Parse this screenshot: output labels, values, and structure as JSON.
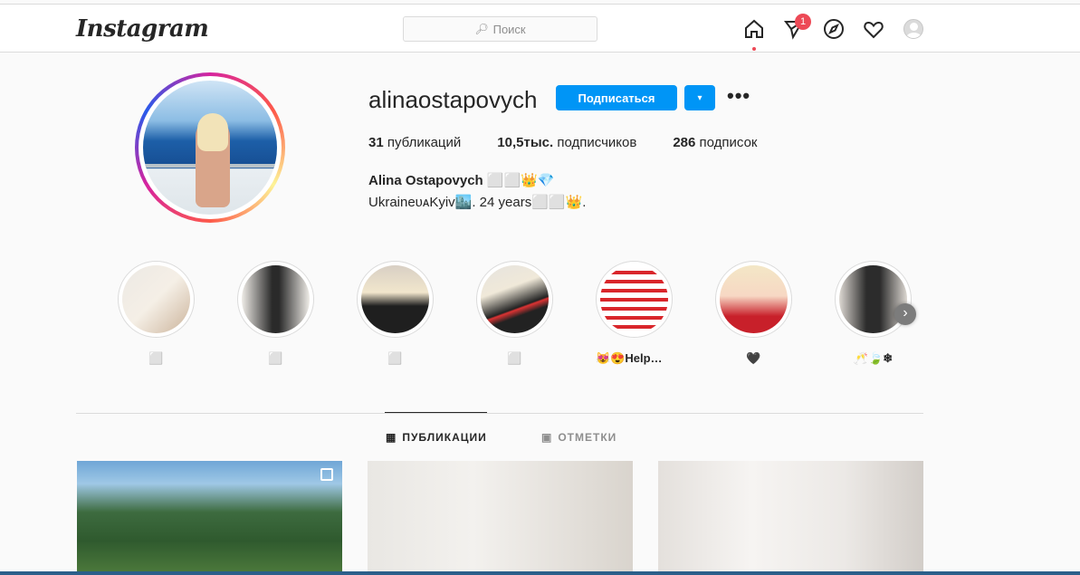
{
  "nav": {
    "logo": "Instagram",
    "search_placeholder": "Поиск",
    "messages_badge": "1",
    "icons": [
      "home-icon",
      "direct-icon",
      "explore-icon",
      "heart-icon",
      "avatar"
    ]
  },
  "profile": {
    "username": "alinaostapovych",
    "follow_label": "Подписаться",
    "dropdown_label": "▾",
    "more_label": "•••",
    "stats": {
      "posts_count": "31",
      "posts_label": "публикаций",
      "followers_count": "10,5тыс.",
      "followers_label": "подписчиков",
      "following_count": "286",
      "following_label": "подписок"
    },
    "full_name": "Alina Ostapovych ⬜⬜👑💎",
    "bio": "UkraineᴜᴀKyiv🏙️. 24 years⬜⬜👑."
  },
  "highlights": [
    {
      "label": "⬜"
    },
    {
      "label": "⬜"
    },
    {
      "label": "⬜"
    },
    {
      "label": "⬜"
    },
    {
      "label": "😻😍Help🐈..."
    },
    {
      "label": "🖤"
    },
    {
      "label": "🥂🍃❄"
    }
  ],
  "highlights_next": "›",
  "tabs": {
    "posts": "ПУБЛИКАЦИИ",
    "tagged": "ОТМЕТКИ"
  },
  "colors": {
    "accent": "#0095f6",
    "badge": "#ed4956"
  }
}
